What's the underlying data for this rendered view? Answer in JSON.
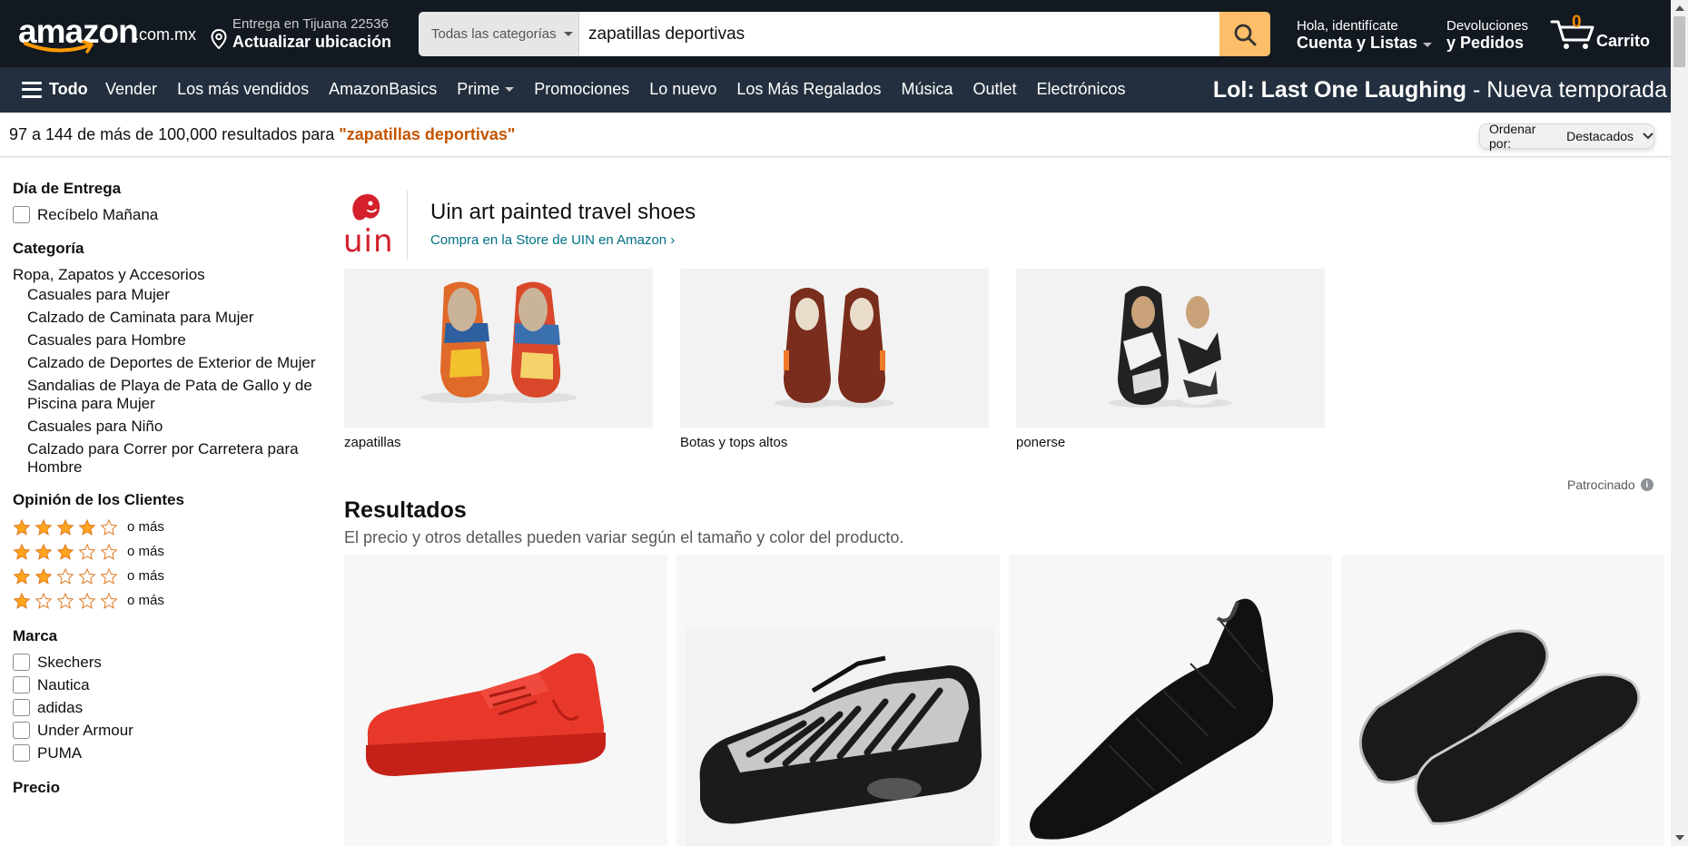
{
  "header": {
    "logo_text": "amazon",
    "logo_tld": ".com.mx",
    "location_line1": "Entrega en Tijuana 22536",
    "location_line2": "Actualizar ubicación",
    "search_category": "Todas las categorías",
    "search_value": "zapatillas deportivas",
    "account_line1": "Hola, identifícate",
    "account_line2": "Cuenta y Listas",
    "returns_line1": "Devoluciones",
    "returns_line2": "y Pedidos",
    "cart_count": "0",
    "cart_label": "Carrito"
  },
  "subnav": {
    "all_label": "Todo",
    "links": [
      "Vender",
      "Los más vendidos",
      "AmazonBasics",
      "Prime",
      "Promociones",
      "Lo nuevo",
      "Los Más Regalados",
      "Música",
      "Outlet",
      "Electrónicos"
    ],
    "promo_bold": "Lol: Last One Laughing",
    "promo_rest": " - Nueva temporada"
  },
  "results_bar": {
    "count_text": "97 a 144 de más de 100,000 resultados para ",
    "query_text": "\"zapatillas deportivas\"",
    "sort_label": "Ordenar por:",
    "sort_value": "Destacados"
  },
  "sidebar": {
    "delivery": {
      "heading": "Día de Entrega",
      "option": "Recíbelo Mañana"
    },
    "category": {
      "heading": "Categoría",
      "root": "Ropa, Zapatos y Accesorios",
      "items": [
        "Casuales para Mujer",
        "Calzado de Caminata para Mujer",
        "Casuales para Hombre",
        "Calzado de Deportes de Exterior de Mujer",
        "Sandalias de Playa de Pata de Gallo y de Piscina para Mujer",
        "Casuales para Niño",
        "Calzado para Correr por Carretera para Hombre"
      ]
    },
    "reviews": {
      "heading": "Opinión de los Clientes",
      "rows": [
        {
          "stars": 4,
          "label": "o más"
        },
        {
          "stars": 3,
          "label": "o más"
        },
        {
          "stars": 2,
          "label": "o más"
        },
        {
          "stars": 1,
          "label": "o más"
        }
      ]
    },
    "brand": {
      "heading": "Marca",
      "items": [
        "Skechers",
        "Nautica",
        "adidas",
        "Under Armour",
        "PUMA"
      ]
    },
    "price": {
      "heading": "Precio"
    }
  },
  "sponsored_brand": {
    "logo_text": "uin",
    "title": "Uin art painted travel shoes",
    "link": "Compra en la Store de UIN en Amazon ›",
    "tiles": [
      {
        "caption": "zapatillas"
      },
      {
        "caption": "Botas y tops altos"
      },
      {
        "caption": "ponerse"
      }
    ],
    "sponsored_label": "Patrocinado"
  },
  "results": {
    "heading": "Resultados",
    "subtitle": "El precio y otros detalles pueden variar según el tamaño y color del producto."
  },
  "colors": {
    "nav_dark": "#131921",
    "nav_sub": "#232f3e",
    "search_button": "#febd69",
    "accent_orange": "#f08804",
    "star": "#ffa41c",
    "link": "#007185",
    "query": "#c45500"
  }
}
